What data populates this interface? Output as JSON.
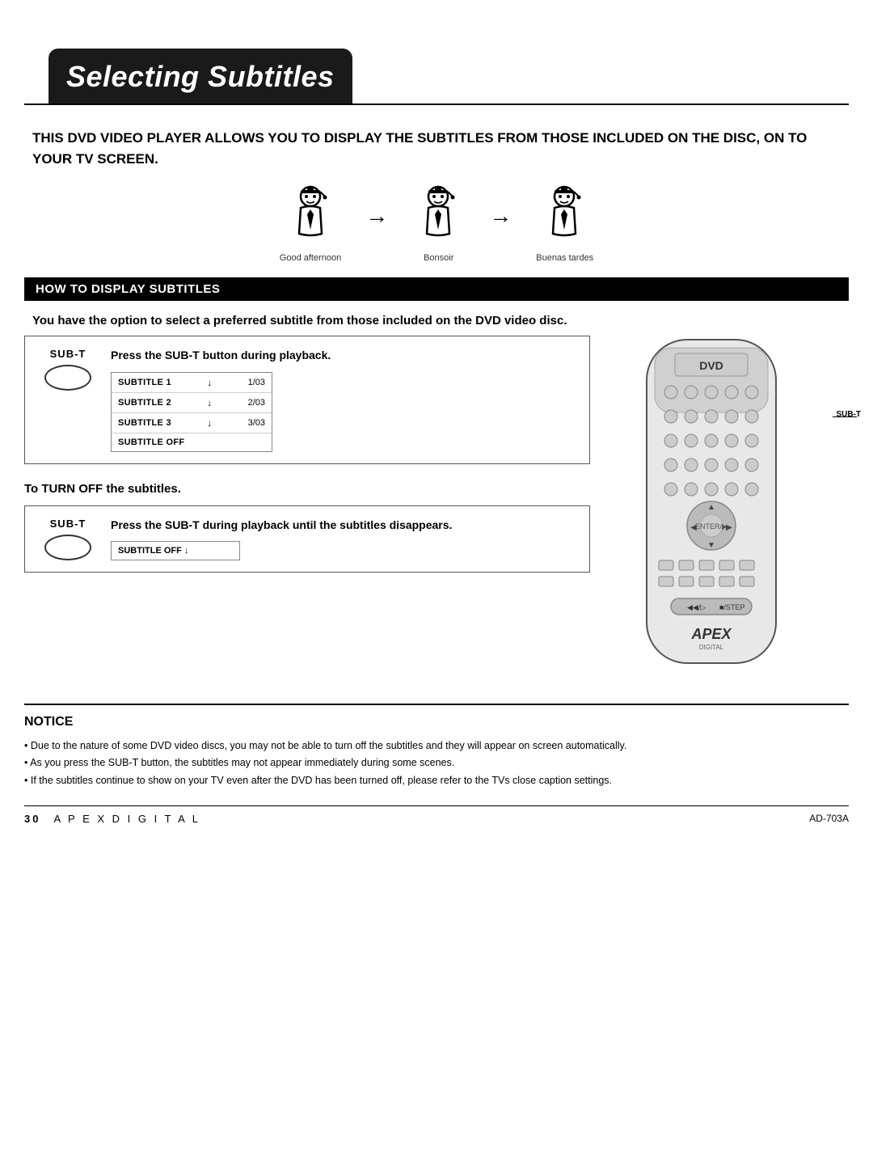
{
  "header": {
    "title": "Selecting Subtitles"
  },
  "intro": {
    "text": "THIS DVD VIDEO PLAYER ALLOWS YOU TO DISPLAY THE SUBTITLES FROM THOSE INCLUDED ON THE DISC, ON TO YOUR TV SCREEN."
  },
  "icons": [
    {
      "label": "Good afternoon"
    },
    {
      "label": "Bonsoir"
    },
    {
      "label": "Buenas tardes"
    }
  ],
  "section": {
    "title": "HOW TO DISPLAY SUBTITLES"
  },
  "how_to_text": "You have the option to select a preferred subtitle from those included on the DVD video disc.",
  "instruction1": {
    "sub_t_label": "SUB-T",
    "press_text": "Press the SUB-T button during playback.",
    "menu_items": [
      {
        "name": "SUBTITLE 1",
        "num": "1/03"
      },
      {
        "name": "SUBTITLE 2",
        "num": "2/03"
      },
      {
        "name": "SUBTITLE 3",
        "num": "3/03"
      },
      {
        "name": "SUBTITLE OFF",
        "num": ""
      }
    ]
  },
  "turn_off_text": "To TURN OFF the subtitles.",
  "instruction2": {
    "sub_t_label": "SUB-T",
    "press_text": "Press the SUB-T during playback until the subtitles disappears.",
    "menu_item": "SUBTITLE OFF ↓"
  },
  "remote_label": "SUB-T",
  "notice": {
    "title": "NOTICE",
    "bullets": [
      "Due to the nature of some DVD video discs, you may not be able to turn off the subtitles and they will appear on screen automatically.",
      "As you press the SUB-T button, the subtitles may not appear immediately during some scenes.",
      "If the subtitles continue to show on your TV even after the DVD has been turned off, please refer to the TVs close caption settings."
    ]
  },
  "footer": {
    "page_number": "30",
    "brand": "A P E X   D I G I T A L",
    "model": "AD-703A"
  }
}
